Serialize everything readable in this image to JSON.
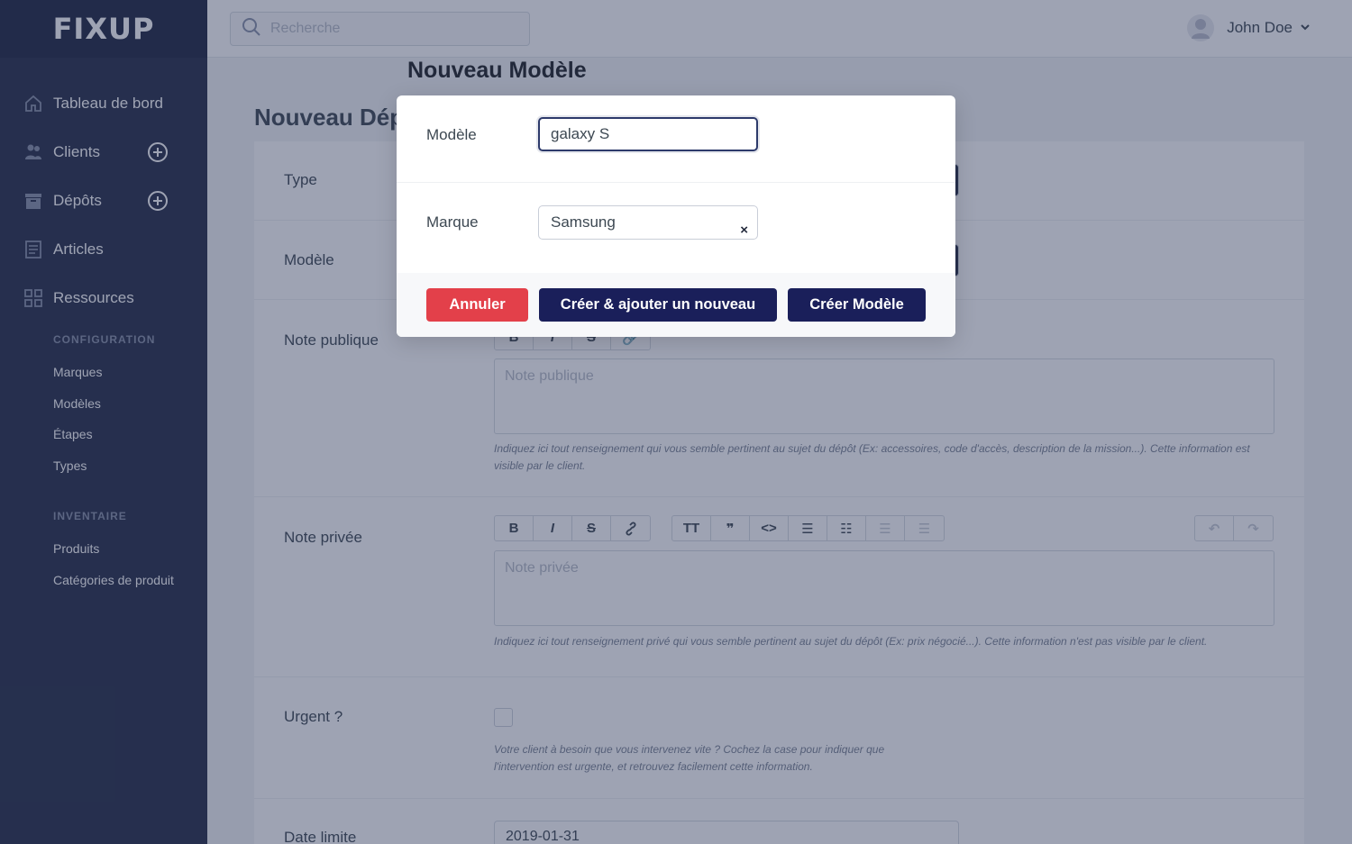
{
  "app": {
    "logo": "FIXUP"
  },
  "sidebar": {
    "nav": [
      {
        "label": "Tableau de bord"
      },
      {
        "label": "Clients"
      },
      {
        "label": "Dépôts"
      },
      {
        "label": "Articles"
      },
      {
        "label": "Ressources"
      }
    ],
    "configuration": {
      "title": "CONFIGURATION",
      "items": [
        "Marques",
        "Modèles",
        "Étapes",
        "Types"
      ]
    },
    "inventaire": {
      "title": "INVENTAIRE",
      "items": [
        "Produits",
        "Catégories de produit"
      ]
    }
  },
  "topbar": {
    "search_placeholder": "Recherche",
    "user_name": "John Doe"
  },
  "page": {
    "title": "Nouveau Dépôt",
    "fields": {
      "type_label": "Type",
      "modele_label": "Modèle",
      "public_note_label": "Note publique",
      "public_note_placeholder": "Note publique",
      "public_note_help": "Indiquez ici tout renseignement qui vous semble pertinent au sujet du dépôt (Ex: accessoires, code d'accès, description de la mission...). Cette information est visible par le client.",
      "private_note_label": "Note privée",
      "private_note_placeholder": "Note privée",
      "private_note_help": "Indiquez ici tout renseignement privé qui vous semble pertinent au sujet du dépôt (Ex: prix négocié...). Cette information n'est pas visible par le client.",
      "urgent_label": "Urgent ?",
      "urgent_help_1": "Votre client à besoin que vous intervenez vite ? Cochez la case pour indiquer que",
      "urgent_help_2": "l'intervention est urgente, et retrouvez facilement cette information.",
      "deadline_label": "Date limite",
      "deadline_value": "2019-01-31"
    }
  },
  "modal": {
    "title": "Nouveau Modèle",
    "modele_label": "Modèle",
    "modele_value": "galaxy S",
    "marque_label": "Marque",
    "marque_value": "Samsung",
    "marque_clear": "×",
    "cancel_label": "Annuler",
    "create_add_label": "Créer & ajouter un nouveau",
    "create_label": "Créer Modèle"
  }
}
